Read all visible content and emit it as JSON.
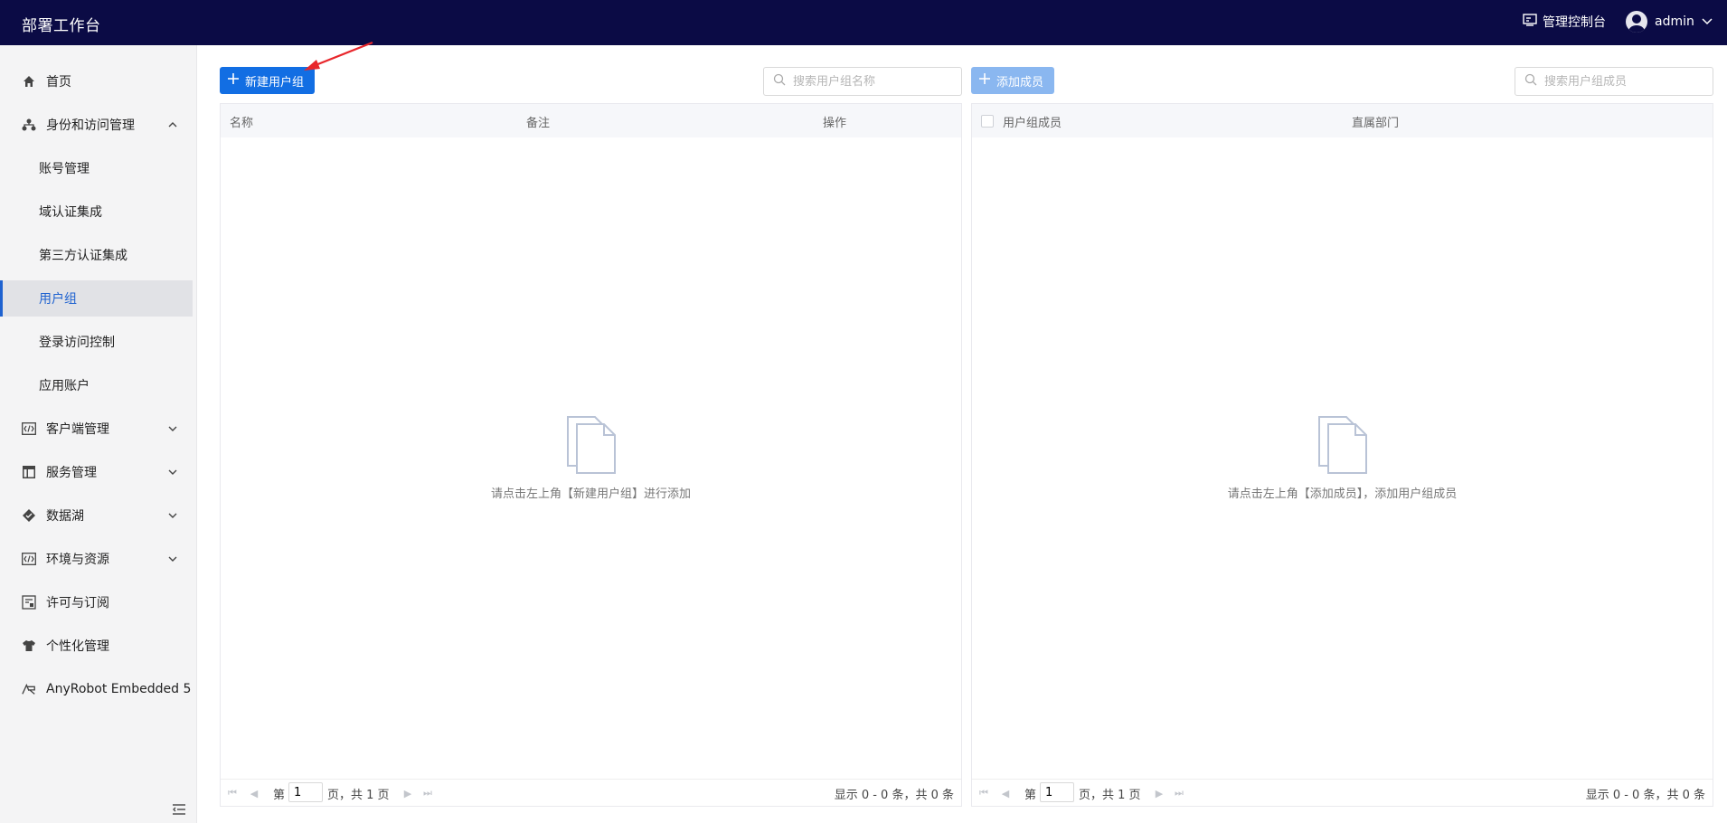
{
  "header": {
    "title": "部署工作台",
    "console_label": "管理控制台",
    "user_name": "admin"
  },
  "sidebar": {
    "items": [
      {
        "label": "首页",
        "icon": "home-icon"
      },
      {
        "label": "身份和访问管理",
        "icon": "org-tree-icon",
        "expanded": true,
        "children": [
          "账号管理",
          "域认证集成",
          "第三方认证集成",
          "用户组",
          "登录访问控制",
          "应用账户"
        ],
        "active_child": "用户组"
      },
      {
        "label": "客户端管理",
        "icon": "code-icon"
      },
      {
        "label": "服务管理",
        "icon": "layout-icon"
      },
      {
        "label": "数据湖",
        "icon": "lake-icon"
      },
      {
        "label": "环境与资源",
        "icon": "code-icon"
      },
      {
        "label": "许可与订阅",
        "icon": "license-icon"
      },
      {
        "label": "个性化管理",
        "icon": "shirt-icon"
      },
      {
        "label": "AnyRobot Embedded 5",
        "icon": "anyrobot-icon"
      }
    ]
  },
  "left_panel": {
    "new_group_button": "新建用户组",
    "search_placeholder": "搜索用户组名称",
    "columns": [
      "名称",
      "备注",
      "操作"
    ],
    "empty_message": "请点击左上角【新建用户组】进行添加",
    "pager": {
      "page_prefix": "第",
      "page_value": "1",
      "page_suffix": "页，共 1 页",
      "info": "显示 0 - 0 条，共 0 条"
    }
  },
  "right_panel": {
    "add_member_button": "添加成员",
    "search_placeholder": "搜索用户组成员",
    "columns": [
      "用户组成员",
      "直属部门"
    ],
    "empty_message": "请点击左上角【添加成员】，添加用户组成员",
    "pager": {
      "page_prefix": "第",
      "page_value": "1",
      "page_suffix": "页，共 1 页",
      "info": "显示 0 - 0 条，共 0 条"
    }
  },
  "colors": {
    "topbar": "#0b0b45",
    "primary": "#126ee3",
    "primary_disabled": "#8ab7f0",
    "active_text": "#1e62d0",
    "annotation_arrow": "#e8262b"
  }
}
